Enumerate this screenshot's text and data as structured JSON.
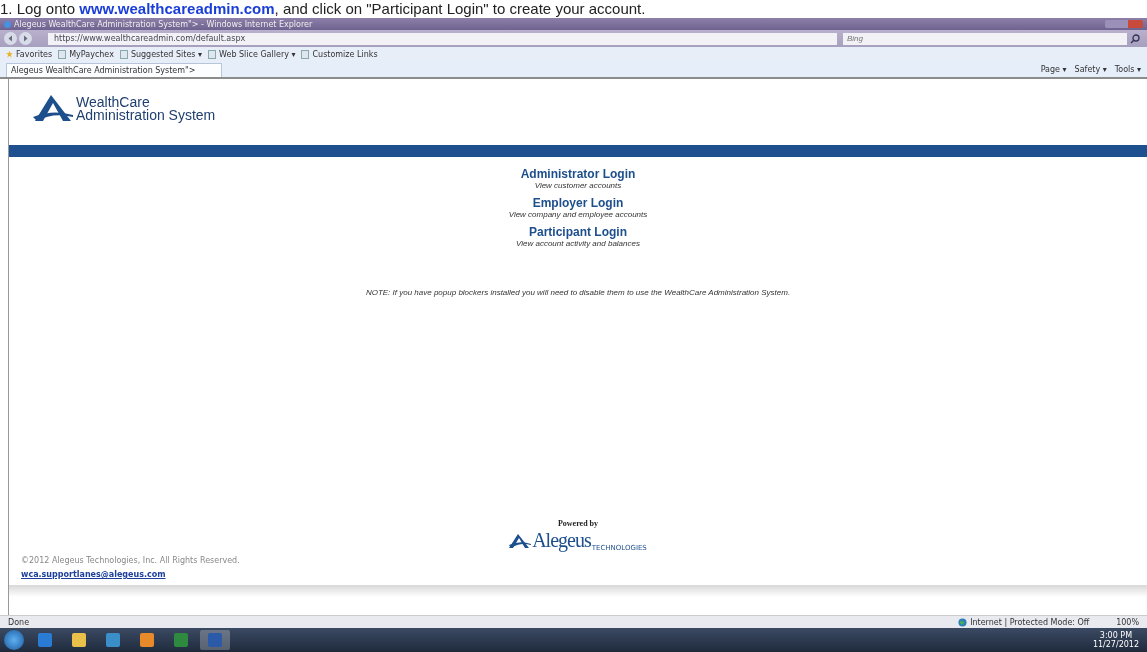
{
  "caption": {
    "prefix": "1. Log onto ",
    "link": "www.wealthcareadmin.com",
    "suffix": ", and click on \"Participant Login\" to create your account."
  },
  "window": {
    "title": "Alegeus WealthCare Administration System\">  - Windows Internet Explorer"
  },
  "address_bar": {
    "url": "https://www.wealthcareadmin.com/default.aspx",
    "search_placeholder": "Bing"
  },
  "favorites_bar": [
    {
      "label": "Favorites",
      "kind": "star"
    },
    {
      "label": "MyPaychex",
      "kind": "page"
    },
    {
      "label": "Suggested Sites ▾",
      "kind": "page"
    },
    {
      "label": "Web Slice Gallery ▾",
      "kind": "page"
    },
    {
      "label": "Customize Links",
      "kind": "page"
    }
  ],
  "tab": {
    "title": "Alegeus WealthCare Administration System\">",
    "selected": true
  },
  "command_bar": [
    "Page ▾",
    "Safety ▾",
    "Tools ▾"
  ],
  "header": {
    "logo_line1": "WealthCare",
    "logo_line2": "Administration System"
  },
  "logins": [
    {
      "title": "Administrator Login",
      "subtitle": "View customer accounts"
    },
    {
      "title": "Employer Login",
      "subtitle": "View company and employee accounts"
    },
    {
      "title": "Participant Login",
      "subtitle": "View account activity and balances"
    }
  ],
  "note": "NOTE: If you have popup blockers installed you will need to disable them to use the WealthCare Administration System.",
  "powered_by": "Powered by",
  "brand": "Alegeus",
  "brand_sub": "TECHNOLOGIES",
  "copyright": "©2012 Alegeus Technologies, Inc. All Rights Reserved.",
  "email": "wca.supportlanes@alegeus.com",
  "status_bar": {
    "left": "Done",
    "zone": "Internet | Protected Mode: Off",
    "zoom": "100%"
  },
  "taskbar": {
    "apps": [
      {
        "kind": "ie",
        "selected": false
      },
      {
        "kind": "folder",
        "selected": false
      },
      {
        "kind": "lync",
        "selected": false
      },
      {
        "kind": "outlook",
        "selected": false
      },
      {
        "kind": "excel",
        "selected": false
      },
      {
        "kind": "word",
        "selected": true
      }
    ],
    "time": "3:00 PM",
    "date": "11/27/2012"
  }
}
